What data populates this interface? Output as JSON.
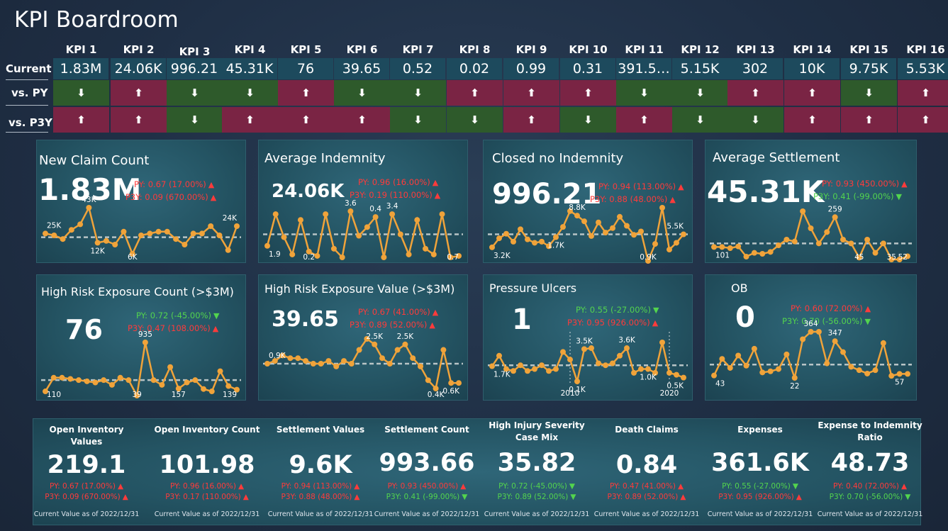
{
  "title": "KPI Boardroom",
  "matrix": {
    "row_labels": {
      "current": "Current",
      "py": "vs. PY",
      "p3y": "vs. P3Y"
    },
    "kpis": [
      {
        "name": "KPI 1",
        "current": "1.83M",
        "py": "down",
        "p3y": "up"
      },
      {
        "name": "KPI 2",
        "current": "24.06K",
        "py": "up",
        "p3y": "up"
      },
      {
        "name": "KPI 3",
        "current": "996.21",
        "py": "down",
        "p3y": "down"
      },
      {
        "name": "KPI 4",
        "current": "45.31K",
        "py": "down",
        "p3y": "up"
      },
      {
        "name": "KPI 5",
        "current": "76",
        "py": "up",
        "p3y": "up"
      },
      {
        "name": "KPI 6",
        "current": "39.65",
        "py": "down",
        "p3y": "up"
      },
      {
        "name": "KPI 7",
        "current": "0.52",
        "py": "down",
        "p3y": "down"
      },
      {
        "name": "KPI 8",
        "current": "0.02",
        "py": "up",
        "p3y": "down"
      },
      {
        "name": "KPI 9",
        "current": "0.99",
        "py": "up",
        "p3y": "up"
      },
      {
        "name": "KPI 10",
        "current": "0.31",
        "py": "up",
        "p3y": "down"
      },
      {
        "name": "KPI 11",
        "current": "391.5…",
        "py": "down",
        "p3y": "up"
      },
      {
        "name": "KPI 12",
        "current": "5.15K",
        "py": "down",
        "p3y": "down"
      },
      {
        "name": "KPI 13",
        "current": "302",
        "py": "up",
        "p3y": "down"
      },
      {
        "name": "KPI 14",
        "current": "10K",
        "py": "up",
        "p3y": "up"
      },
      {
        "name": "KPI 15",
        "current": "9.75K",
        "py": "down",
        "p3y": "up"
      },
      {
        "name": "KPI 16",
        "current": "5.53K",
        "py": "up",
        "p3y": "up"
      }
    ],
    "colors": {
      "up": "#7a2444",
      "down": "#2e5a2b"
    },
    "icons": {
      "up": "arrow-up-icon",
      "down": "arrow-down-icon"
    }
  },
  "cards": [
    {
      "title": "New Claim Count",
      "value": "1.83M",
      "py": "PY:  0.67 (17.00%)",
      "py_dir": "up",
      "p3y": "P3Y:  0.09 (670.00%)",
      "p3y_dir": "up"
    },
    {
      "title": "Average Indemnity",
      "value": "24.06K",
      "py": "PY:  0.96 (16.00%)",
      "py_dir": "up",
      "p3y": "P3Y:  0.19 (110.00%)",
      "p3y_dir": "up"
    },
    {
      "title": "Closed no Indemnity",
      "value": "996.21",
      "py": "PY:  0.94 (113.00%)",
      "py_dir": "up",
      "p3y": "P3Y:  0.88 (48.00%)",
      "p3y_dir": "up"
    },
    {
      "title": "Average Settlement",
      "value": "45.31K",
      "py": "PY:  0.93 (450.00%)",
      "py_dir": "up",
      "p3y": "P3Y:  0.41 (-99.00%)",
      "p3y_dir": "down"
    },
    {
      "title": "High Risk Exposure Count (>$3M)",
      "value": "76",
      "py": "PY:  0.72 (-45.00%)",
      "py_dir": "down",
      "p3y": "P3Y:  0.47 (108.00%)",
      "p3y_dir": "up"
    },
    {
      "title": "High Risk Exposure Value (>$3M)",
      "value": "39.65",
      "py": "PY:  0.67 (41.00%)",
      "py_dir": "up",
      "p3y": "P3Y:  0.89 (52.00%)",
      "p3y_dir": "up"
    },
    {
      "title": "Pressure Ulcers",
      "value": "1",
      "py": "PY:  0.55 (-27.00%)",
      "py_dir": "down",
      "p3y": "P3Y:  0.95 (926.00%)",
      "p3y_dir": "up"
    },
    {
      "title": "OB",
      "value": "0",
      "py": "PY:  0.60 (72.00%)",
      "py_dir": "up",
      "p3y": "P3Y:  0.70 (-56.00%)",
      "p3y_dir": "down"
    }
  ],
  "chart_data": [
    {
      "type": "line",
      "name": "New Claim Count trend",
      "values": [
        20,
        19,
        17,
        22,
        25,
        34,
        15,
        16,
        14,
        21,
        9,
        19,
        20,
        21,
        21,
        17,
        14,
        20,
        20,
        24,
        19,
        11,
        24
      ],
      "labels": [
        {
          "i": 0,
          "text": "25K"
        },
        {
          "i": 5,
          "text": "43K"
        },
        {
          "i": 6,
          "text": "12K"
        },
        {
          "i": 10,
          "text": "6K"
        },
        {
          "i": 22,
          "text": "24K"
        }
      ],
      "avg": 18
    },
    {
      "type": "line",
      "name": "Average Indemnity trend",
      "values": [
        1.2,
        3.4,
        1.8,
        0.6,
        3.0,
        0.8,
        0.5,
        3.4,
        1.0,
        0.4,
        3.6,
        1.9,
        2.5,
        3.2,
        0.4,
        3.4,
        2.0,
        0.6,
        3.0,
        1.0,
        0.6,
        3.4,
        0.4,
        0.5
      ],
      "labels": [
        {
          "i": 0,
          "text": "1.9"
        },
        {
          "i": 5,
          "text": "0.2"
        },
        {
          "i": 10,
          "text": "3.6"
        },
        {
          "i": 13,
          "text": "0.4"
        },
        {
          "i": 15,
          "text": "3.4"
        },
        {
          "i": 23,
          "text": "0.7"
        }
      ],
      "avg": 2.0
    },
    {
      "type": "line",
      "name": "Closed no Indemnity trend",
      "values": [
        3.2,
        4.8,
        5.6,
        4.2,
        6.4,
        4.6,
        4.0,
        4.2,
        3.4,
        5.0,
        6.8,
        9.6,
        8.8,
        7.8,
        5.2,
        7.6,
        5.8,
        6.6,
        8.6,
        7.0,
        5.4,
        6.0,
        0.8,
        3.8,
        10.2,
        2.8,
        4.0,
        5.5
      ],
      "labels": [
        {
          "i": 0,
          "text": "3.2K"
        },
        {
          "i": 9,
          "text": "1.7K"
        },
        {
          "i": 12,
          "text": "8.8K"
        },
        {
          "i": 22,
          "text": "0.9K"
        },
        {
          "i": 27,
          "text": "5.5K"
        }
      ],
      "avg": 5.5
    },
    {
      "type": "line",
      "name": "Average Settlement trend",
      "values": [
        101,
        101,
        95,
        104,
        50,
        70,
        65,
        75,
        110,
        140,
        130,
        290,
        200,
        120,
        180,
        259,
        140,
        120,
        45,
        140,
        70,
        120,
        35,
        35,
        52
      ],
      "labels": [
        {
          "i": 0,
          "text": "101"
        },
        {
          "i": 15,
          "text": "259"
        },
        {
          "i": 18,
          "text": "45"
        },
        {
          "i": 22,
          "text": "35"
        },
        {
          "i": 24,
          "text": "52"
        }
      ],
      "avg": 120
    },
    {
      "type": "line",
      "name": "High Risk Exposure Count trend",
      "values": [
        110,
        340,
        340,
        320,
        300,
        280,
        260,
        300,
        220,
        340,
        300,
        39,
        935,
        300,
        220,
        520,
        157,
        260,
        300,
        150,
        110,
        450,
        200,
        139
      ],
      "labels": [
        {
          "i": 0,
          "text": "110"
        },
        {
          "i": 11,
          "text": "39"
        },
        {
          "i": 12,
          "text": "935"
        },
        {
          "i": 16,
          "text": "157"
        },
        {
          "i": 23,
          "text": "139"
        }
      ],
      "avg": 300
    },
    {
      "type": "line",
      "name": "High Risk Exposure Value trend",
      "values": [
        1.3,
        1.4,
        1.6,
        1.5,
        1.5,
        1.4,
        1.3,
        1.3,
        1.4,
        1.2,
        1.4,
        1.3,
        1.8,
        2.2,
        2.0,
        1.5,
        1.3,
        1.8,
        2.0,
        1.5,
        1.2,
        0.7,
        0.4,
        1.8,
        0.6,
        0.6
      ],
      "labels": [
        {
          "i": 0,
          "text": "0.9K"
        },
        {
          "i": 14,
          "text": "2.5K"
        },
        {
          "i": 18,
          "text": "2.5K"
        },
        {
          "i": 22,
          "text": "0.4K"
        },
        {
          "i": 24,
          "text": "0.6K"
        }
      ],
      "avg": 1.3
    },
    {
      "type": "line",
      "name": "Pressure Ulcers trend",
      "values": [
        1.7,
        2.8,
        1.4,
        1.2,
        1.8,
        1.2,
        1.4,
        1.8,
        1.2,
        1.4,
        3.2,
        2.4,
        0.1,
        3.5,
        3.6,
        2.0,
        1.8,
        2.0,
        2.8,
        3.6,
        1.0,
        1.4,
        1.4,
        1.0,
        4.2,
        1.0,
        0.8,
        0.5
      ],
      "labels": [
        {
          "i": 0,
          "text": "1.7K"
        },
        {
          "i": 12,
          "text": "0.1K"
        },
        {
          "i": 13,
          "text": "3.5K"
        },
        {
          "i": 19,
          "text": "3.6K"
        },
        {
          "i": 22,
          "text": "1.0K"
        },
        {
          "i": 27,
          "text": "0.5K"
        }
      ],
      "markers": [
        {
          "i": 11,
          "text": "2010"
        },
        {
          "i": 25,
          "text": "2020"
        }
      ],
      "avg": 1.8
    },
    {
      "type": "line",
      "name": "OB trend",
      "values": [
        43,
        190,
        110,
        220,
        130,
        280,
        70,
        80,
        100,
        230,
        22,
        364,
        430,
        430,
        150,
        347,
        250,
        120,
        90,
        60,
        90,
        330,
        40,
        57,
        57
      ],
      "labels": [
        {
          "i": 0,
          "text": "43"
        },
        {
          "i": 10,
          "text": "22"
        },
        {
          "i": 12,
          "text": "364"
        },
        {
          "i": 15,
          "text": "347"
        },
        {
          "i": 23,
          "text": "57"
        }
      ],
      "avg": 140
    }
  ],
  "bottom": [
    {
      "title": "Open Inventory Values",
      "value": "219.1",
      "py": "PY:  0.67 (17.00%)",
      "py_dir": "up",
      "p3y": "P3Y:  0.09 (670.00%)",
      "p3y_dir": "up",
      "foot": "Current Value as of 2022/12/31"
    },
    {
      "title": "Open Inventory Count",
      "value": "101.98",
      "py": "PY:  0.96 (16.00%)",
      "py_dir": "up",
      "p3y": "P3Y:  0.17 (110.00%)",
      "p3y_dir": "up",
      "foot": "Current Value as of 2022/12/31"
    },
    {
      "title": "Settlement Values",
      "value": "9.6K",
      "py": "PY:  0.94 (113.00%)",
      "py_dir": "up",
      "p3y": "P3Y:  0.88 (48.00%)",
      "p3y_dir": "up",
      "foot": "Current Value as of 2022/12/31"
    },
    {
      "title": "Settlement Count",
      "value": "993.66",
      "py": "PY:  0.93 (450.00%)",
      "py_dir": "up",
      "p3y": "P3Y:  0.41 (-99.00%)",
      "p3y_dir": "down",
      "foot": "Current Value as of 2022/12/31"
    },
    {
      "title": "High Injury Severity Case Mix",
      "value": "35.82",
      "py": "PY:  0.72 (-45.00%)",
      "py_dir": "down",
      "p3y": "P3Y:  0.89 (52.00%)",
      "p3y_dir": "down",
      "foot": "Current Value as of 2022/12/31"
    },
    {
      "title": "Death Claims",
      "value": "0.84",
      "py": "PY:  0.47 (41.00%)",
      "py_dir": "up",
      "p3y": "P3Y:  0.89 (52.00%)",
      "p3y_dir": "up",
      "foot": "Current Value as of 2022/12/31"
    },
    {
      "title": "Expenses",
      "value": "361.6K",
      "py": "PY:  0.55 (-27.00%)",
      "py_dir": "down",
      "p3y": "P3Y:  0.95 (926.00%)",
      "p3y_dir": "up",
      "foot": "Current Value as of 2022/12/31"
    },
    {
      "title": "Expense to Indemnity Ratio",
      "value": "48.73",
      "py": "PY:  0.40 (72.00%)",
      "py_dir": "up",
      "p3y": "P3Y:  0.70 (-56.00%)",
      "p3y_dir": "down",
      "foot": "Current Value as of 2022/12/31"
    }
  ],
  "colors": {
    "line": "#f0a33a",
    "avg": "#b8c4c6",
    "up": "#ff3b3b",
    "down": "#53d44e"
  }
}
